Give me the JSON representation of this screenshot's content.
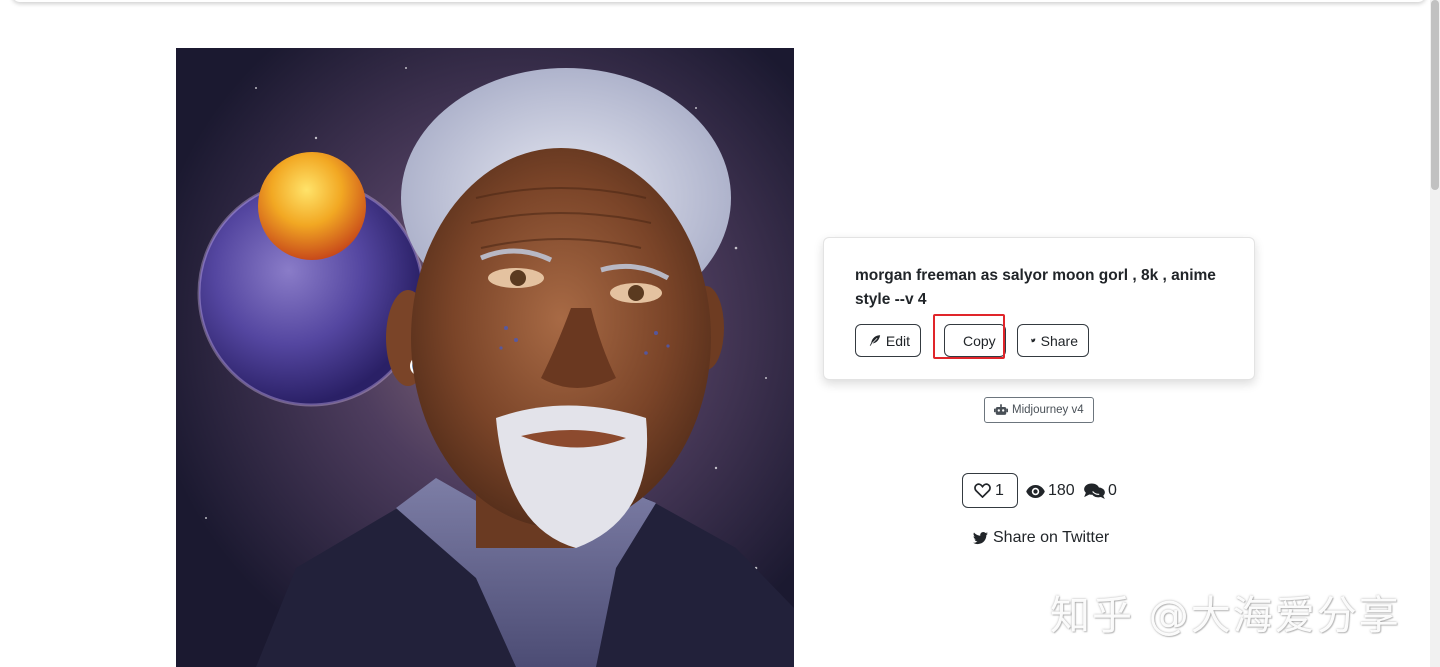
{
  "prompt": {
    "text": "morgan freeman as salyor moon gorl , 8k , anime style --v 4",
    "buttons": {
      "edit": "Edit",
      "copy": "Copy",
      "share": "Share"
    }
  },
  "model_badge": "Midjourney v4",
  "stats": {
    "likes": "1",
    "views": "180",
    "comments": "0"
  },
  "share_twitter": "Share on Twitter",
  "watermark": "知乎 @大海爱分享",
  "icons": {
    "edit": "feather-icon",
    "copy": "copy-icon",
    "share": "twitter-icon",
    "model": "robot-icon",
    "like": "heart-icon",
    "views": "eye-icon",
    "comments": "comments-icon"
  },
  "colors": {
    "highlight": "#e0252a",
    "text": "#212529",
    "border": "#343a40"
  }
}
